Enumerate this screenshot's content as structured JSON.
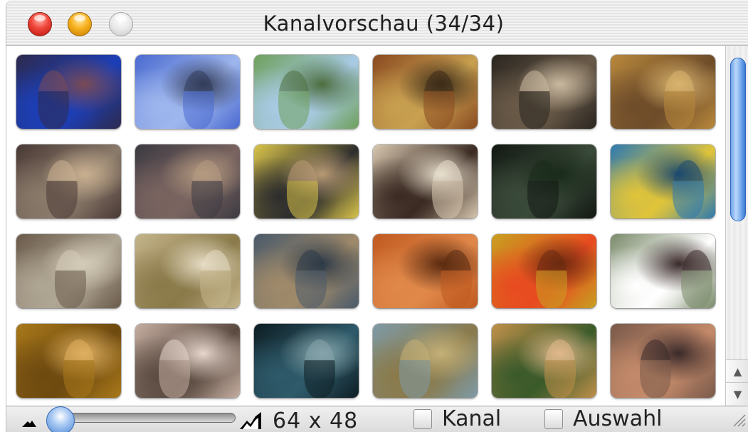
{
  "window": {
    "title": "Kanalvorschau (34/34)"
  },
  "thumbnails": [
    {
      "colors": [
        "#2d2a4e",
        "#1c3fb8",
        "#7a4a54"
      ]
    },
    {
      "colors": [
        "#4a6ad0",
        "#9fb7ee",
        "#323c5a"
      ]
    },
    {
      "colors": [
        "#6ea05c",
        "#a9cbe6",
        "#4d6e3e"
      ]
    },
    {
      "colors": [
        "#8a4a20",
        "#c8a050",
        "#3b2a18"
      ]
    },
    {
      "colors": [
        "#2a2620",
        "#6a5a48",
        "#c9b9a0"
      ]
    },
    {
      "colors": [
        "#b8883c",
        "#6e4c2a",
        "#d9b46e"
      ]
    },
    {
      "colors": [
        "#4a3a36",
        "#8a7a6a",
        "#c9b090"
      ]
    },
    {
      "colors": [
        "#3c3a42",
        "#7a6460",
        "#b49a80"
      ]
    },
    {
      "colors": [
        "#d9c44a",
        "#2d2d2d",
        "#b89a74"
      ]
    },
    {
      "colors": [
        "#d8c8b0",
        "#3a2a22",
        "#e9dfcd"
      ]
    },
    {
      "colors": [
        "#121812",
        "#3a4a3a",
        "#1a2a1a"
      ]
    },
    {
      "colors": [
        "#2d7ab0",
        "#e0c43a",
        "#1c4a6e"
      ]
    },
    {
      "colors": [
        "#6a5a4a",
        "#b0a694",
        "#d4cab8"
      ]
    },
    {
      "colors": [
        "#c4b48a",
        "#8a7a4a",
        "#e6dcc4"
      ]
    },
    {
      "colors": [
        "#4a5a6a",
        "#a08a6a",
        "#2d3a48"
      ]
    },
    {
      "colors": [
        "#c05a20",
        "#e0884a",
        "#5a2a10"
      ]
    },
    {
      "colors": [
        "#c8a020",
        "#e84a20",
        "#6a2a10"
      ]
    },
    {
      "colors": [
        "#7a8a6a",
        "#ffffff",
        "#3a2a2a"
      ]
    },
    {
      "colors": [
        "#a8781a",
        "#6e4a10",
        "#e0b060"
      ]
    },
    {
      "colors": [
        "#c4aca0",
        "#5a4a40",
        "#e6d6cc"
      ]
    },
    {
      "colors": [
        "#0e1e24",
        "#2e5a6a",
        "#86a4aa"
      ]
    },
    {
      "colors": [
        "#7e9aa6",
        "#8a7a4a",
        "#c4b078"
      ]
    },
    {
      "colors": [
        "#c0904a",
        "#3a5a2a",
        "#e0b88a"
      ]
    },
    {
      "colors": [
        "#7a5a4a",
        "#c48a6a",
        "#3a2a2a"
      ]
    }
  ],
  "slider": {
    "level": 0.0
  },
  "size_label": "64 x 48",
  "checkboxes": {
    "kanal": {
      "label": "Kanal",
      "checked": false
    },
    "auswahl": {
      "label": "Auswahl",
      "checked": false
    }
  }
}
